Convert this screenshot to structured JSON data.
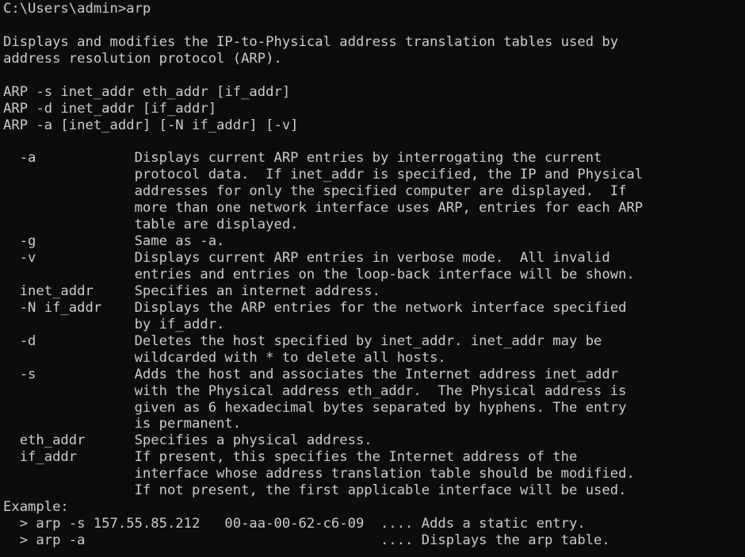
{
  "terminal": {
    "prompt": "C:\\Users\\admin>",
    "command": "arp",
    "lines": [
      "",
      "Displays and modifies the IP-to-Physical address translation tables used by",
      "address resolution protocol (ARP).",
      "",
      "ARP -s inet_addr eth_addr [if_addr]",
      "ARP -d inet_addr [if_addr]",
      "ARP -a [inet_addr] [-N if_addr] [-v]",
      "",
      "  -a            Displays current ARP entries by interrogating the current",
      "                protocol data.  If inet_addr is specified, the IP and Physical",
      "                addresses for only the specified computer are displayed.  If",
      "                more than one network interface uses ARP, entries for each ARP",
      "                table are displayed.",
      "  -g            Same as -a.",
      "  -v            Displays current ARP entries in verbose mode.  All invalid",
      "                entries and entries on the loop-back interface will be shown.",
      "  inet_addr     Specifies an internet address.",
      "  -N if_addr    Displays the ARP entries for the network interface specified",
      "                by if_addr.",
      "  -d            Deletes the host specified by inet_addr. inet_addr may be",
      "                wildcarded with * to delete all hosts.",
      "  -s            Adds the host and associates the Internet address inet_addr",
      "                with the Physical address eth_addr.  The Physical address is",
      "                given as 6 hexadecimal bytes separated by hyphens. The entry",
      "                is permanent.",
      "  eth_addr      Specifies a physical address.",
      "  if_addr       If present, this specifies the Internet address of the",
      "                interface whose address translation table should be modified.",
      "                If not present, the first applicable interface will be used.",
      "Example:",
      "  > arp -s 157.55.85.212   00-aa-00-62-c6-09  .... Adds a static entry.",
      "  > arp -a                                    .... Displays the arp table."
    ]
  }
}
